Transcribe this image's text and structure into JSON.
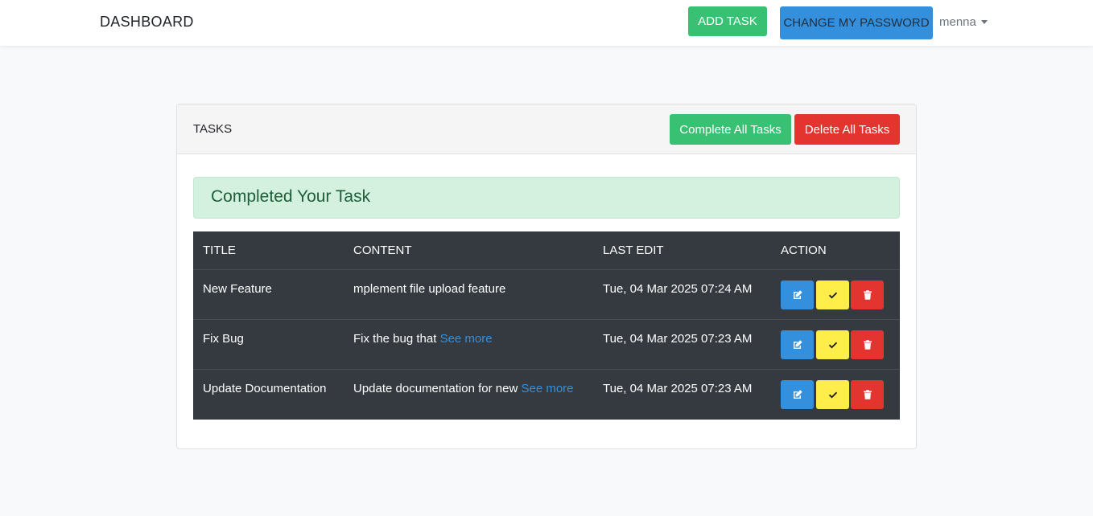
{
  "navbar": {
    "brand": "DASHBOARD",
    "add_task_label": "ADD TASK",
    "change_password_label": "CHANGE MY PASSWORD",
    "username": "menna"
  },
  "tasks_card": {
    "title": "TASKS",
    "complete_all_label": "Complete All Tasks",
    "delete_all_label": "Delete All Tasks",
    "alert_message": "Completed Your Task"
  },
  "table": {
    "headers": [
      "TITLE",
      "CONTENT",
      "LAST EDIT",
      "ACTION"
    ],
    "rows": [
      {
        "title": "New Feature",
        "content": "mplement file upload feature",
        "see_more": "",
        "last_edit": "Tue, 04 Mar 2025 07:24 AM"
      },
      {
        "title": "Fix Bug",
        "content": "Fix the bug that",
        "see_more": "See more",
        "last_edit": "Tue, 04 Mar 2025 07:23 AM"
      },
      {
        "title": "Update Documentation",
        "content": "Update documentation for new",
        "see_more": "See more",
        "last_edit": "Tue, 04 Mar 2025 07:23 AM"
      }
    ],
    "action_icons": [
      "edit-icon",
      "check-icon",
      "trash-icon"
    ]
  },
  "colors": {
    "green": "#38c172",
    "blue": "#3490dc",
    "red": "#e3342f",
    "yellow": "#ffed4a",
    "table_dark": "#343a40",
    "alert_bg": "#d4f0de"
  }
}
